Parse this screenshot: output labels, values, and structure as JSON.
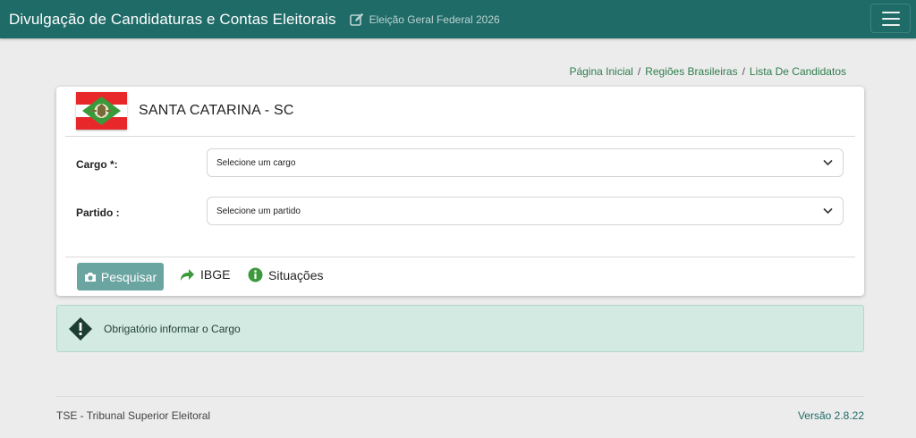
{
  "header": {
    "title": "Divulgação de Candidaturas e Contas Eleitorais",
    "election_label": "Eleição Geral Federal 2026",
    "edit_icon": "edit-icon",
    "menu_icon": "hamburger-menu-icon"
  },
  "breadcrumb": {
    "items": [
      "Página Inicial",
      "Regiões Brasileiras",
      "Lista De Candidatos"
    ],
    "separator": "/"
  },
  "state": {
    "name": "SANTA CATARINA - SC",
    "flag_icon": "santa-catarina-flag"
  },
  "form": {
    "cargo_label": "Cargo *:",
    "cargo_value": "Selecione um cargo",
    "partido_label": "Partido :",
    "partido_value": "Selecione um partido"
  },
  "actions": {
    "search_label": "Pesquisar",
    "ibge_label": "IBGE",
    "situacoes_label": "Situações"
  },
  "alert": {
    "message": "Obrigatório informar o Cargo"
  },
  "footer": {
    "left": "TSE - Tribunal Superior Eleitoral",
    "right": "Versão 2.8.22"
  },
  "colors": {
    "header_bg": "#1f6b67",
    "link_green": "#2e7d4c",
    "search_button": "#6aa5a1",
    "alert_bg": "#d3eae2",
    "icon_green": "#3c9a3c"
  }
}
